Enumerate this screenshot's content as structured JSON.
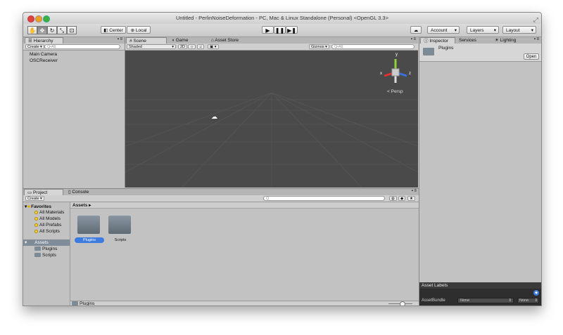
{
  "window": {
    "title": "Untitled - PerlinNoiseDeformation - PC, Mac & Linux Standalone (Personal) <OpenGL 3.3>"
  },
  "toolbar": {
    "center_label": "Center",
    "local_label": "Local",
    "account_label": "Account",
    "layers_label": "Layers",
    "layout_label": "Layout"
  },
  "hierarchy": {
    "tab": "Hierarchy",
    "create_label": "Create",
    "search_placeholder": "Q•All",
    "items": [
      "Main Camera",
      "OSCReceiver"
    ]
  },
  "scene": {
    "tabs": [
      "Scene",
      "Game",
      "Asset Store"
    ],
    "shading": "Shaded",
    "mode_2d": "2D",
    "gizmos_label": "Gizmos",
    "search_placeholder": "Q•All",
    "persp_label": "Persp",
    "axes": {
      "x": "x",
      "y": "y",
      "z": "z"
    }
  },
  "inspector": {
    "tabs": [
      "Inspector",
      "Services",
      "Lighting"
    ],
    "asset_name": "Plugins",
    "open_label": "Open",
    "asset_labels_title": "Asset Labels",
    "asset_bundle_label": "AssetBundle",
    "bundle_value": "None",
    "variant_value": "None"
  },
  "project": {
    "tabs": [
      "Project",
      "Console"
    ],
    "create_label": "Create",
    "favorites_label": "Favorites",
    "favorites": [
      "All Materials",
      "All Models",
      "All Prefabs",
      "All Scripts"
    ],
    "assets_label": "Assets",
    "asset_folders": [
      "Plugins",
      "Scripts"
    ],
    "breadcrumb": "Assets",
    "grid_folders": [
      "Plugins",
      "Scripts"
    ],
    "status_path": "Plugins"
  },
  "colors": {
    "scene_bg": "#4a4a4a",
    "selection": "#3d7be0",
    "panel": "#c2c2c2"
  }
}
